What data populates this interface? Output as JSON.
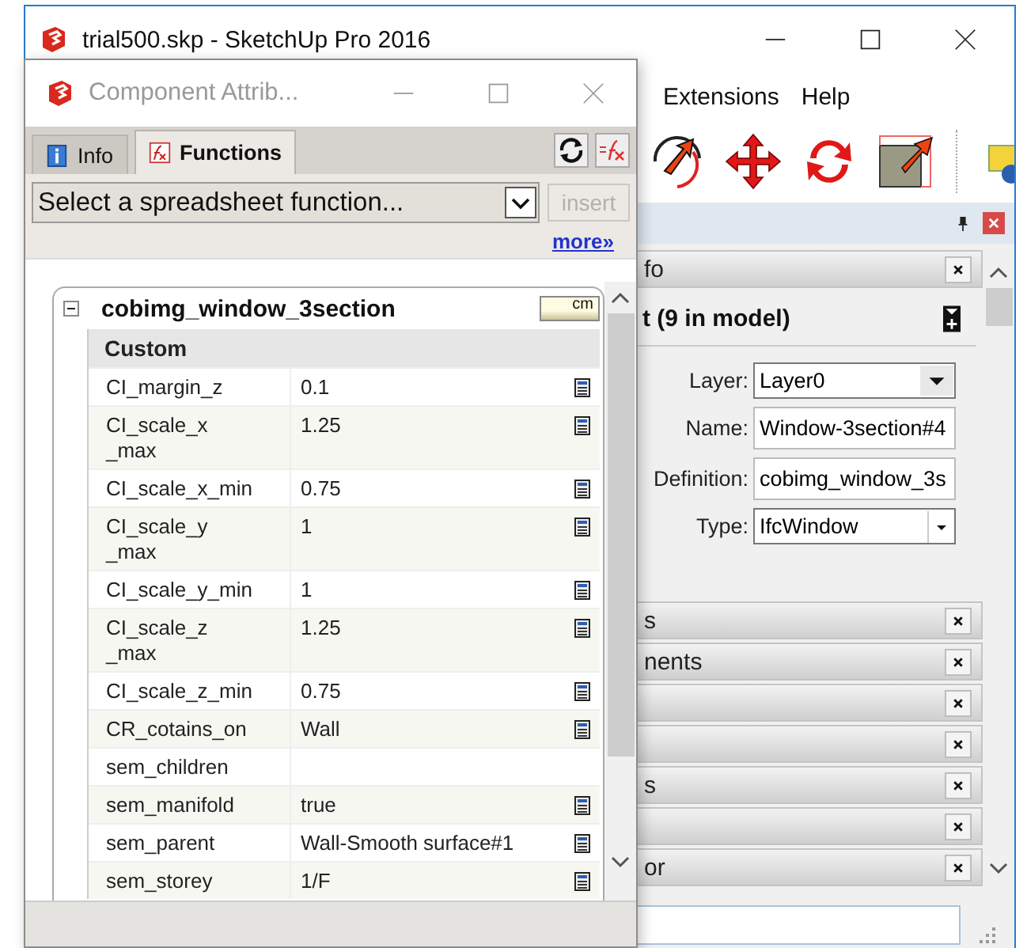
{
  "main_window": {
    "title": "trial500.skp - SketchUp Pro 2016"
  },
  "menu": [
    {
      "label": "Extensions"
    },
    {
      "label": "Help"
    }
  ],
  "tray": {
    "entity_info": {
      "title": "fo",
      "selection": "t (9 in model)",
      "fields": [
        {
          "label": "Layer:",
          "value": "Layer0",
          "kind": "dropdown"
        },
        {
          "label": "Name:",
          "value": "Window-3section#4",
          "kind": "text"
        },
        {
          "label": "Definition:",
          "value": "cobimg_window_3s",
          "kind": "text"
        },
        {
          "label": "Type:",
          "value": "IfcWindow",
          "kind": "combo"
        }
      ]
    },
    "panels": [
      {
        "title": "s",
        "closable": true
      },
      {
        "title": "nents",
        "closable": true
      },
      {
        "closable": true
      },
      {
        "closable": true
      },
      {
        "title": "s",
        "closable": true
      },
      {
        "closable": true
      },
      {
        "title": "or",
        "closable": true
      }
    ]
  },
  "dialog": {
    "title": "Component Attrib...",
    "tabs": [
      {
        "label": "Info",
        "selected": false
      },
      {
        "label": "Functions",
        "selected": true
      }
    ],
    "function_select": {
      "value": "Select a spreadsheet function..."
    },
    "insert_button": {
      "label": "insert",
      "disabled": true
    },
    "more_link": "more»",
    "component": {
      "name": "cobimg_window_3section",
      "unit": "cm",
      "expanded": true,
      "section": "Custom",
      "rows": [
        {
          "name": "CI_margin_z",
          "value": "0.1",
          "editable": true
        },
        {
          "name": "CI_scale_x\n_max",
          "value": "1.25",
          "editable": true
        },
        {
          "name": "CI_scale_x_min",
          "value": "0.75",
          "editable": true
        },
        {
          "name": "CI_scale_y\n_max",
          "value": "1",
          "editable": true
        },
        {
          "name": "CI_scale_y_min",
          "value": "1",
          "editable": true
        },
        {
          "name": "CI_scale_z\n_max",
          "value": "1.25",
          "editable": true
        },
        {
          "name": "CI_scale_z_min",
          "value": "0.75",
          "editable": true
        },
        {
          "name": "CR_cotains_on",
          "value": "Wall",
          "editable": true
        },
        {
          "name": "sem_children",
          "editable": false
        },
        {
          "name": "sem_manifold",
          "value": "true",
          "editable": true
        },
        {
          "name": "sem_parent",
          "value": "Wall-Smooth surface#1",
          "editable": true
        },
        {
          "name": "sem_storey",
          "value": "1/F",
          "editable": true
        }
      ]
    }
  }
}
